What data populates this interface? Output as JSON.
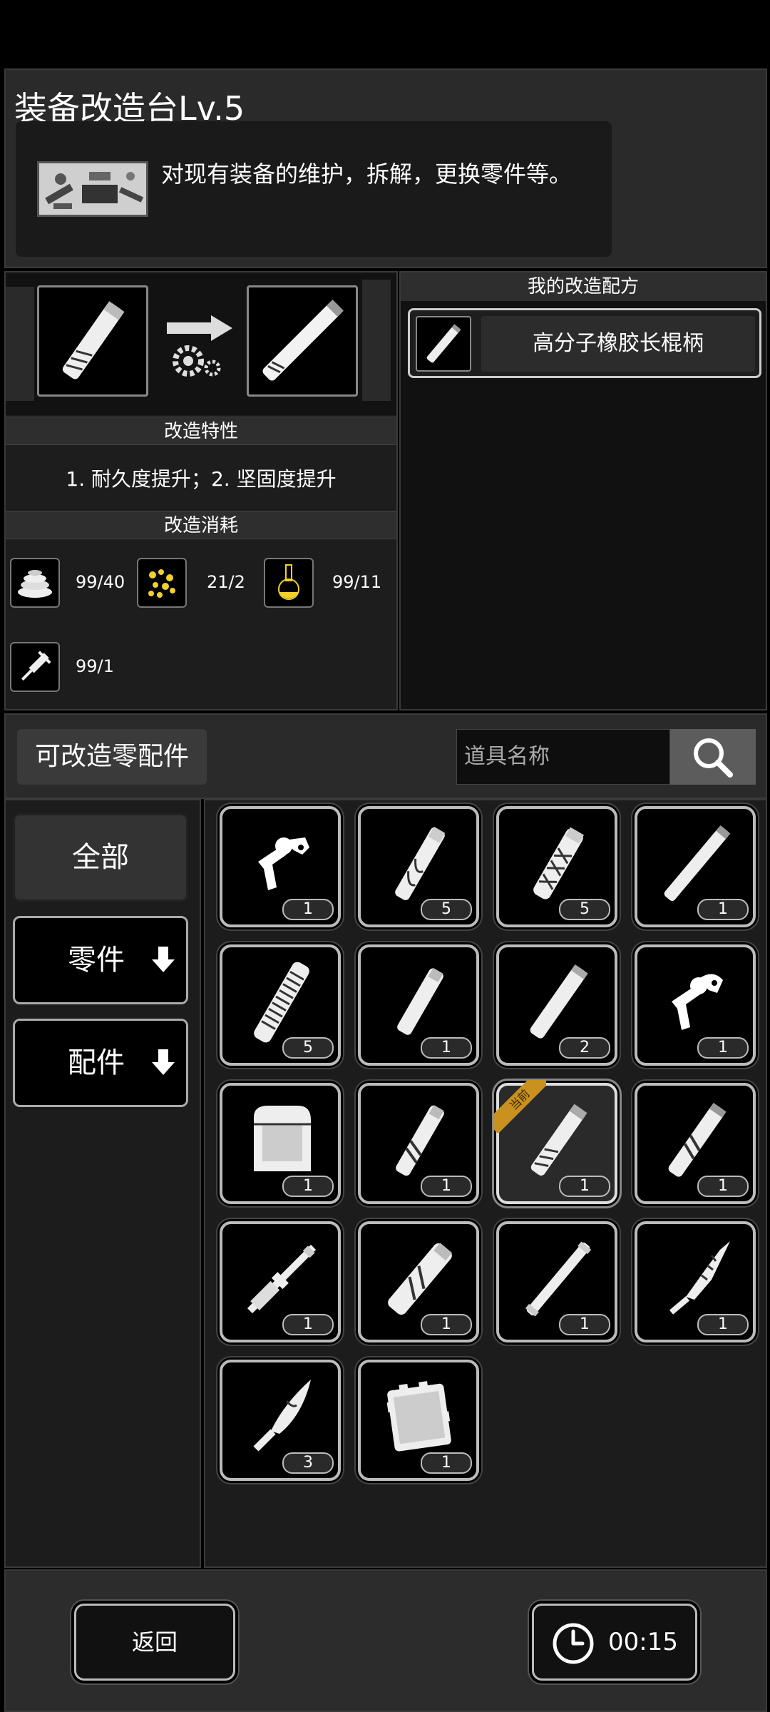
{
  "header": {
    "title": "装备改造台Lv.5",
    "description": "对现有装备的维护，拆解，更换零件等。"
  },
  "upgrade": {
    "traits_title": "改造特性",
    "traits_text": "1. 耐久度提升；2. 坚固度提升",
    "cost_title": "改造消耗",
    "costs": [
      {
        "icon": "rubber-coil-icon",
        "value": "99/40"
      },
      {
        "icon": "gold-nuggets-icon",
        "value": "21/2"
      },
      {
        "icon": "chemical-flask-icon",
        "value": "99/11"
      },
      {
        "icon": "syringe-tool-icon",
        "value": "99/1"
      }
    ]
  },
  "recipes": {
    "title": "我的改造配方",
    "items": [
      {
        "icon": "handle-icon",
        "label": "高分子橡胶长棍柄"
      }
    ]
  },
  "parts": {
    "title": "可改造零配件",
    "search_placeholder": "道具名称",
    "categories": {
      "all": "全部",
      "parts": "零件",
      "accessories": "配件"
    },
    "equipped_label": "当前",
    "slots": [
      {
        "icon": "trigger-icon",
        "count": "1"
      },
      {
        "icon": "wrapped-handle-icon",
        "count": "5"
      },
      {
        "icon": "braided-handle-icon",
        "count": "5"
      },
      {
        "icon": "long-handle-icon",
        "count": "1"
      },
      {
        "icon": "grip-handle-icon",
        "count": "5"
      },
      {
        "icon": "short-handle-icon",
        "count": "1"
      },
      {
        "icon": "plain-handle-icon",
        "count": "2"
      },
      {
        "icon": "trigger-icon",
        "count": "1"
      },
      {
        "icon": "pouch-icon",
        "count": "1"
      },
      {
        "icon": "taped-handle-icon",
        "count": "1"
      },
      {
        "icon": "handle-icon",
        "count": "1",
        "equipped": true
      },
      {
        "icon": "taped-handle-icon",
        "count": "1"
      },
      {
        "icon": "rod-handle-icon",
        "count": "1"
      },
      {
        "icon": "thick-handle-icon",
        "count": "1"
      },
      {
        "icon": "staff-icon",
        "count": "1"
      },
      {
        "icon": "serrated-blade-icon",
        "count": "1"
      },
      {
        "icon": "machete-icon",
        "count": "3"
      },
      {
        "icon": "armor-plate-icon",
        "count": "1"
      }
    ]
  },
  "footer": {
    "back_label": "返回",
    "timer": "00:15"
  }
}
